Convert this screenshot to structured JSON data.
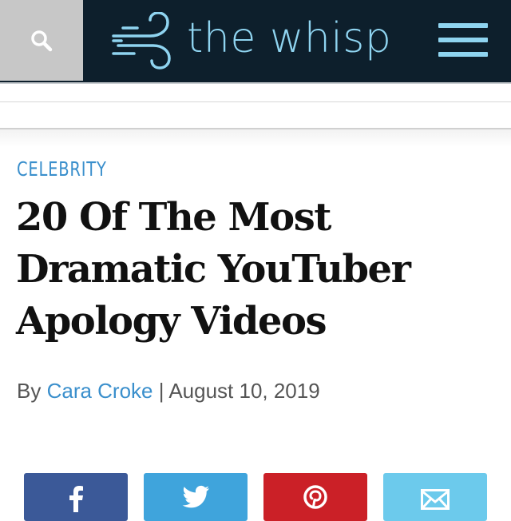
{
  "header": {
    "site_name": "the whisp",
    "background": "#0d1f2c",
    "accent": "#8fd4f0",
    "search_icon": "search-icon",
    "menu_icon": "hamburger-menu-icon"
  },
  "article": {
    "category": "CELEBRITY",
    "headline": "20 Of The Most Dramatic YouTuber Apology Videos",
    "by_label": "By",
    "author": "Cara Croke",
    "separator": "|",
    "date": "August 10, 2019",
    "link_color": "#3a8fcc"
  },
  "share": [
    {
      "network": "facebook",
      "icon": "facebook-icon",
      "color": "#3b5998"
    },
    {
      "network": "twitter",
      "icon": "twitter-icon",
      "color": "#3fa4dc"
    },
    {
      "network": "pinterest",
      "icon": "pinterest-icon",
      "color": "#cb2027"
    },
    {
      "network": "email",
      "icon": "email-icon",
      "color": "#6ccaec"
    }
  ]
}
